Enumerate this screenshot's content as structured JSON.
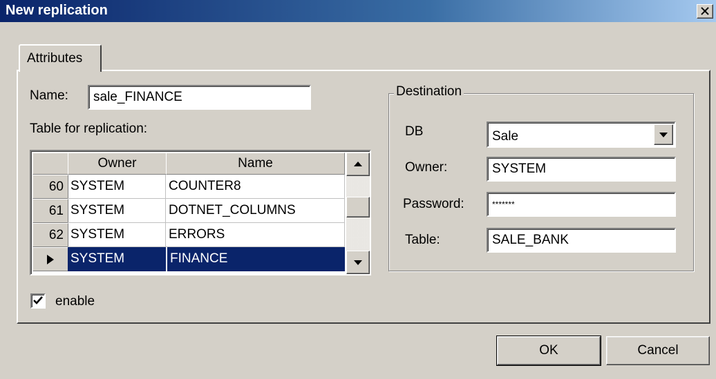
{
  "window": {
    "title": "New replication",
    "close_label": "x"
  },
  "tabs": [
    {
      "label": "Attributes",
      "active": true
    }
  ],
  "form": {
    "name_label": "Name:",
    "name_value": "sale_FINANCE",
    "table_label": "Table for replication:",
    "enable_label": "enable",
    "enable_checked": true
  },
  "grid": {
    "columns": [
      "Owner",
      "Name"
    ],
    "rows": [
      {
        "num": "60",
        "owner": "SYSTEM",
        "name": "COUNTER8"
      },
      {
        "num": "61",
        "owner": "SYSTEM",
        "name": "DOTNET_COLUMNS"
      },
      {
        "num": "62",
        "owner": "SYSTEM",
        "name": "ERRORS"
      },
      {
        "num": "",
        "owner": "SYSTEM",
        "name": "FINANCE",
        "selected": true
      }
    ]
  },
  "destination": {
    "title": "Destination",
    "db_label": "DB",
    "db_value": "Sale",
    "owner_label": "Owner:",
    "owner_value": "SYSTEM",
    "password_label": "Password:",
    "password_value": "*******",
    "table_label": "Table:",
    "table_value": "SALE_BANK"
  },
  "buttons": {
    "ok": "OK",
    "cancel": "Cancel"
  },
  "colors": {
    "titlebar_start": "#0a246a",
    "titlebar_end": "#a6caf0",
    "selection": "#0a246a",
    "face": "#d4d0c8"
  }
}
